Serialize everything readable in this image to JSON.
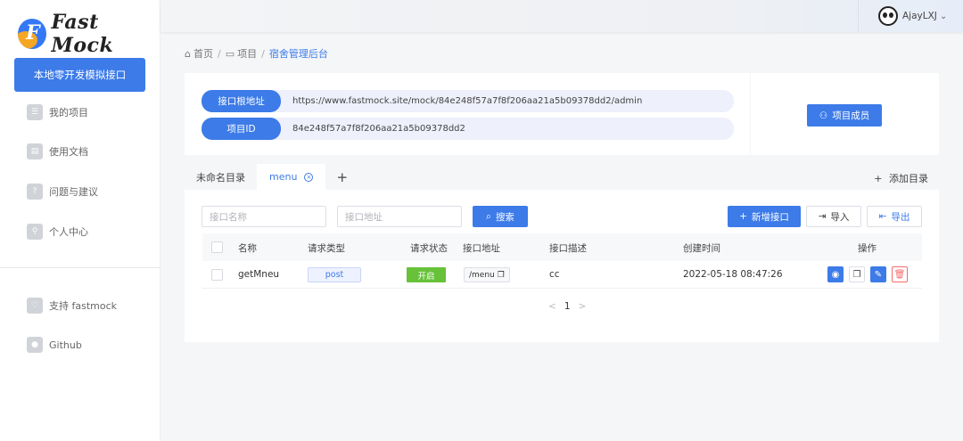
{
  "brand": {
    "name": "Fast Mock"
  },
  "sidebar": {
    "primary_action": "本地零开发模拟接口",
    "items": [
      {
        "label": "我的项目",
        "icon": "list-icon"
      },
      {
        "label": "使用文档",
        "icon": "document-icon"
      },
      {
        "label": "问题与建议",
        "icon": "question-icon"
      },
      {
        "label": "个人中心",
        "icon": "user-icon"
      }
    ],
    "bottom_items": [
      {
        "label": "支持 fastmock",
        "icon": "heart-icon"
      },
      {
        "label": "Github",
        "icon": "github-icon"
      }
    ]
  },
  "header": {
    "username": "AjayLXJ",
    "caret": "⌄"
  },
  "breadcrumb": {
    "home": "首页",
    "project": "项目",
    "current": "宿舍管理后台"
  },
  "project_info": {
    "root_url_label": "接口根地址",
    "root_url": "https://www.fastmock.site/mock/84e248f57a7f8f206aa21a5b09378dd2/admin",
    "id_label": "项目ID",
    "id": "84e248f57a7f8f206aa21a5b09378dd2",
    "members_button": "项目成员"
  },
  "tabs": {
    "items": [
      {
        "label": "未命名目录"
      },
      {
        "label": "menu"
      }
    ],
    "add_symbol": "+",
    "add_directory": "添加目录"
  },
  "filters": {
    "name_placeholder": "接口名称",
    "path_placeholder": "接口地址",
    "search_button": "搜索",
    "new_button": "新增接口",
    "import_button": "导入",
    "export_button": "导出"
  },
  "table": {
    "columns": [
      "名称",
      "请求类型",
      "请求状态",
      "接口地址",
      "接口描述",
      "创建时间",
      "操作"
    ],
    "rows": [
      {
        "name": "getMneu",
        "method": "post",
        "status": "开启",
        "path": "/menu",
        "description": "cc",
        "created": "2022-05-18 08:47:26"
      }
    ]
  },
  "pagination": {
    "current": "1",
    "prev": "<",
    "next": ">"
  },
  "colors": {
    "primary": "#3c7be8",
    "success": "#67c23a",
    "danger": "#f56c6c"
  }
}
